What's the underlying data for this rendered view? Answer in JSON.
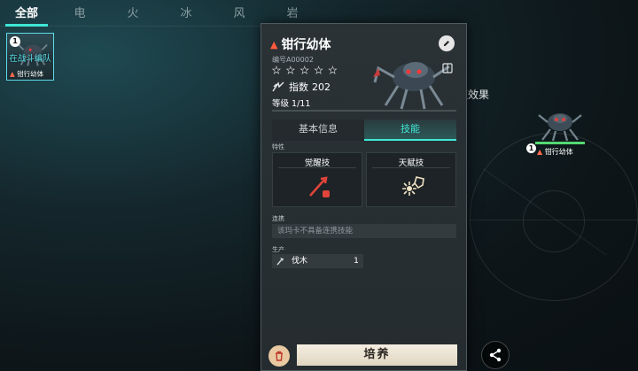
{
  "filter_tabs": [
    "全部",
    "电",
    "火",
    "冰",
    "风",
    "岩"
  ],
  "active_tab_index": 0,
  "roster": {
    "slot_number": "1",
    "status": "在战斗编队",
    "name": "钳行幼体"
  },
  "team_panel": {
    "label": "伍效果",
    "member_number": "1",
    "member_name": "钳行幼体",
    "member_health": 1.0
  },
  "detail": {
    "name": "钳行幼体",
    "serial": "编号A00002",
    "stars_filled": 0,
    "stars_total": 5,
    "index_label": "指数",
    "index_value": "202",
    "level_label": "等级",
    "level_value": "1/11",
    "subtabs": [
      "基本信息",
      "技能"
    ],
    "active_subtab_index": 1,
    "traits_label": "特性",
    "skill_awaken_title": "觉醒技",
    "skill_talent_title": "天赋技",
    "combo_label": "连携",
    "combo_text": "该玛卡不具备连携技能",
    "production_label": "生产",
    "production_item": "伐木",
    "production_value": "1",
    "train_button": "培养"
  },
  "colors": {
    "accent": "#3fe8d6",
    "fire": "#ff5a3c",
    "health": "#55d872",
    "train_button": "#efe6d4"
  },
  "icons": [
    "fire-icon",
    "edit-icon",
    "index-icon",
    "book-icon",
    "awaken-skill-icon",
    "talent-skill-icon",
    "axe-icon",
    "trash-icon",
    "share-icon"
  ]
}
